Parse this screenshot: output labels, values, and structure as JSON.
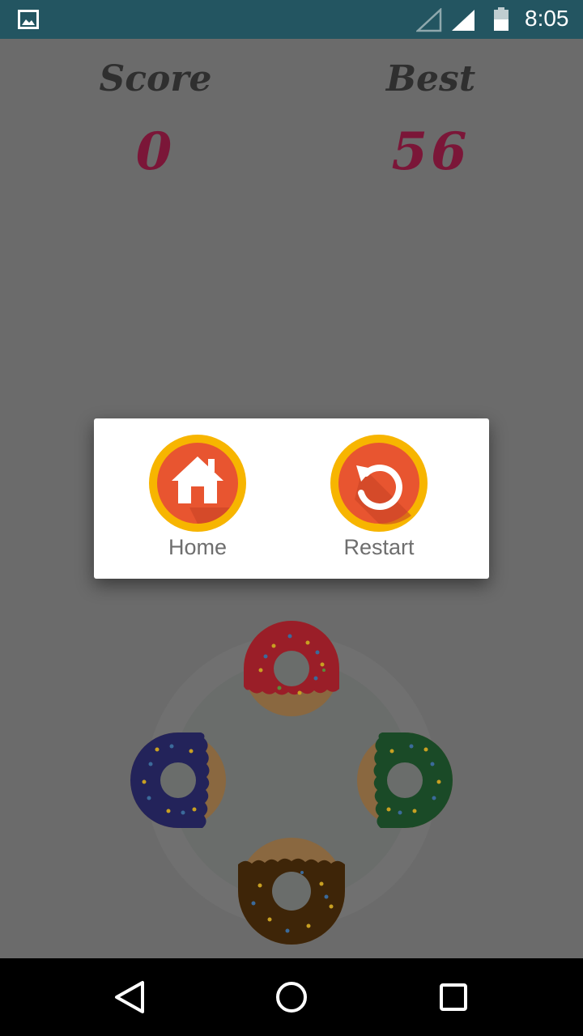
{
  "status_bar": {
    "time": "8:05",
    "icons": [
      "gallery-icon",
      "signal-empty-icon",
      "signal-full-icon",
      "battery-icon"
    ]
  },
  "game": {
    "score_label": "Score",
    "score_value": "0",
    "best_label": "Best",
    "best_value": "56"
  },
  "dialog": {
    "home_label": "Home",
    "restart_label": "Restart"
  },
  "donuts": [
    {
      "name": "red",
      "frosting": "#b52430"
    },
    {
      "name": "blue",
      "frosting": "#2a2a6e"
    },
    {
      "name": "green",
      "frosting": "#1f5a2e"
    },
    {
      "name": "chocolate",
      "frosting": "#4a2f10"
    }
  ],
  "nav_bar": {
    "icons": [
      "back-icon",
      "home-circle-icon",
      "recents-icon"
    ]
  },
  "colors": {
    "status_bar": "#235561",
    "overlay": "#6b6b6b",
    "score_text": "#7b1638",
    "button_orange": "#e85530",
    "button_ring": "#f7b500"
  }
}
